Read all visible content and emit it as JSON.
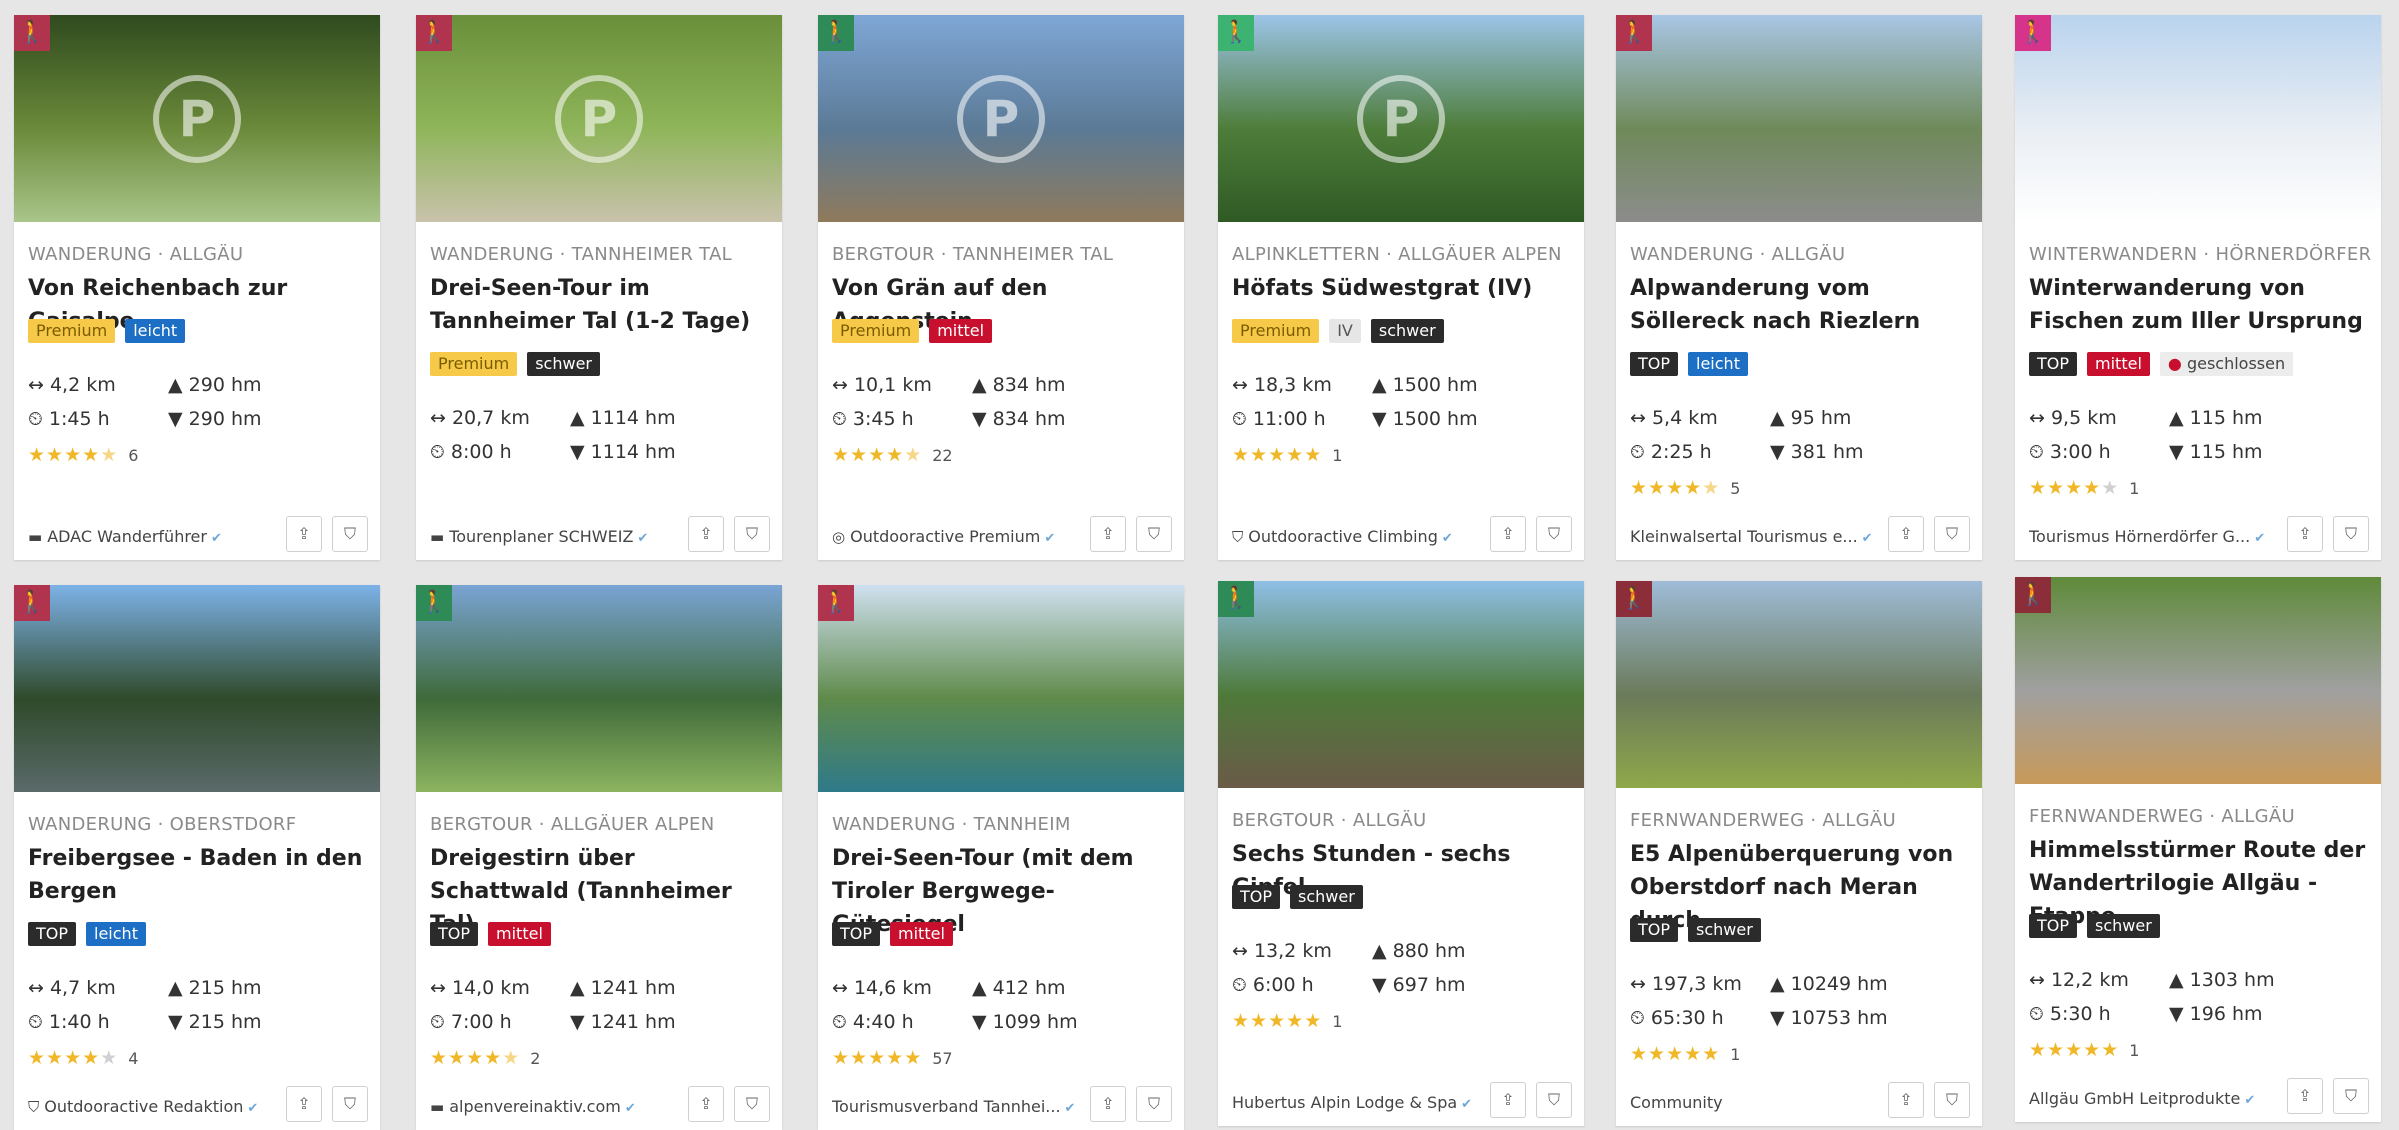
{
  "cards": [
    {
      "category": "WANDERUNG · ALLGÄU",
      "title": "Von Reichenbach zur Gaisalpe",
      "badge_color": "#b0344d",
      "image_colors": [
        "#2f4a1e",
        "#6b8a3a",
        "#a9c58a"
      ],
      "premium_watermark": true,
      "tags": [
        {
          "label": "Premium",
          "kind": "prem"
        },
        {
          "label": "leicht",
          "kind": "leicht"
        }
      ],
      "distance": "4,2 km",
      "duration": "1:45 h",
      "ascent": "290 hm",
      "descent": "290 hm",
      "rating": 4.5,
      "rating_count": "6",
      "author": "ADAC Wanderführer",
      "author_logo": "flag-icon",
      "verified": true
    },
    {
      "category": "WANDERUNG · TANNHEIMER TAL",
      "title": "Drei-Seen-Tour im Tannheimer Tal (1-2 Tage)",
      "badge_color": "#b0344d",
      "image_colors": [
        "#6a8f3a",
        "#8fb55a",
        "#c9c2ac"
      ],
      "premium_watermark": true,
      "tags": [
        {
          "label": "Premium",
          "kind": "prem"
        },
        {
          "label": "schwer",
          "kind": "schwer"
        }
      ],
      "distance": "20,7 km",
      "duration": "8:00 h",
      "ascent": "1114 hm",
      "descent": "1114 hm",
      "rating": 0,
      "rating_count": "",
      "author": "Tourenplaner SCHWEIZ",
      "author_logo": "flag-icon",
      "verified": true
    },
    {
      "category": "BERGTOUR · TANNHEIMER TAL",
      "title": "Von Grän auf den Aggenstein",
      "badge_color": "#2e8b57",
      "image_colors": [
        "#7fa7d6",
        "#5b7a96",
        "#8f7a5c"
      ],
      "premium_watermark": true,
      "tags": [
        {
          "label": "Premium",
          "kind": "prem"
        },
        {
          "label": "mittel",
          "kind": "mittel"
        }
      ],
      "distance": "10,1 km",
      "duration": "3:45 h",
      "ascent": "834 hm",
      "descent": "834 hm",
      "rating": 4.5,
      "rating_count": "22",
      "author": "Outdooractive Premium",
      "author_logo": "premium-icon",
      "verified": true
    },
    {
      "category": "ALPINKLETTERN · ALLGÄUER ALPEN",
      "title": "Höfats Südwestgrat (IV)",
      "badge_color": "#3cb371",
      "image_colors": [
        "#9cc4e8",
        "#4e7d3a",
        "#2f5a25"
      ],
      "premium_watermark": true,
      "tags": [
        {
          "label": "Premium",
          "kind": "prem"
        },
        {
          "label": "IV",
          "kind": "iv"
        },
        {
          "label": "schwer",
          "kind": "schwer"
        }
      ],
      "distance": "18,3 km",
      "duration": "11:00 h",
      "ascent": "1500 hm",
      "descent": "1500 hm",
      "rating": 5,
      "rating_count": "1",
      "author": "Outdooractive Climbing",
      "author_logo": "shield-icon",
      "verified": true
    },
    {
      "category": "WANDERUNG · ALLGÄU",
      "title": "Alpwanderung vom Söllereck nach Riezlern",
      "badge_color": "#b0344d",
      "image_colors": [
        "#a9c6e6",
        "#6f8a5a",
        "#8c8c8c"
      ],
      "premium_watermark": false,
      "tags": [
        {
          "label": "TOP",
          "kind": "top"
        },
        {
          "label": "leicht",
          "kind": "leicht"
        }
      ],
      "distance": "5,4 km",
      "duration": "2:25 h",
      "ascent": "95 hm",
      "descent": "381 hm",
      "rating": 4.5,
      "rating_count": "5",
      "author": "Kleinwalsertal Tourismus e...",
      "author_logo": "",
      "verified": true
    },
    {
      "category": "WINTERWANDERN · HÖRNERDÖRFER",
      "title": "Winterwanderung von Fischen zum Iller Ursprung",
      "badge_color": "#d6338a",
      "image_colors": [
        "#b9d3ee",
        "#e9eef4",
        "#ffffff"
      ],
      "premium_watermark": false,
      "tags": [
        {
          "label": "TOP",
          "kind": "top"
        },
        {
          "label": "mittel",
          "kind": "mittel"
        },
        {
          "label": "geschlossen",
          "kind": "closed"
        }
      ],
      "distance": "9,5 km",
      "duration": "3:00 h",
      "ascent": "115 hm",
      "descent": "115 hm",
      "rating": 4,
      "rating_count": "1",
      "author": "Tourismus Hörnerdörfer G...",
      "author_logo": "",
      "verified": true
    },
    {
      "category": "WANDERUNG · OBERSTDORF",
      "title": "Freibergsee - Baden in den Bergen",
      "badge_color": "#b0344d",
      "image_colors": [
        "#7db2e8",
        "#2f4a2a",
        "#5a6a6a"
      ],
      "premium_watermark": false,
      "tags": [
        {
          "label": "TOP",
          "kind": "top"
        },
        {
          "label": "leicht",
          "kind": "leicht"
        }
      ],
      "distance": "4,7 km",
      "duration": "1:40 h",
      "ascent": "215 hm",
      "descent": "215 hm",
      "rating": 4,
      "rating_count": "4",
      "author": "Outdooractive Redaktion",
      "author_logo": "shield-icon",
      "verified": true
    },
    {
      "category": "BERGTOUR · ALLGÄUER ALPEN",
      "title": "Dreigestirn über Schattwald (Tannheimer Tal)",
      "badge_color": "#2e8b57",
      "image_colors": [
        "#7aa4d4",
        "#3f6a3a",
        "#8cb460"
      ],
      "premium_watermark": false,
      "tags": [
        {
          "label": "TOP",
          "kind": "top"
        },
        {
          "label": "mittel",
          "kind": "mittel"
        }
      ],
      "distance": "14,0 km",
      "duration": "7:00 h",
      "ascent": "1241 hm",
      "descent": "1241 hm",
      "rating": 4.5,
      "rating_count": "2",
      "author": "alpenvereinaktiv.com",
      "author_logo": "flag-icon",
      "verified": true
    },
    {
      "category": "WANDERUNG · TANNHEIM",
      "title": "Drei-Seen-Tour (mit dem Tiroler Bergwege-Gütesiegel",
      "badge_color": "#b0344d",
      "image_colors": [
        "#cfe0f0",
        "#5f8a4a",
        "#2f7a8a"
      ],
      "premium_watermark": false,
      "tags": [
        {
          "label": "TOP",
          "kind": "top"
        },
        {
          "label": "mittel",
          "kind": "mittel"
        }
      ],
      "distance": "14,6 km",
      "duration": "4:40 h",
      "ascent": "412 hm",
      "descent": "1099 hm",
      "rating": 5,
      "rating_count": "57",
      "author": "Tourismusverband Tannhei...",
      "author_logo": "",
      "verified": true
    },
    {
      "category": "BERGTOUR · ALLGÄU",
      "title": "Sechs Stunden - sechs Gipfel",
      "badge_color": "#2e8b57",
      "image_colors": [
        "#8fbfe6",
        "#4e7a3a",
        "#6a5a48"
      ],
      "premium_watermark": false,
      "tags": [
        {
          "label": "TOP",
          "kind": "top"
        },
        {
          "label": "schwer",
          "kind": "schwer"
        }
      ],
      "distance": "13,2 km",
      "duration": "6:00 h",
      "ascent": "880 hm",
      "descent": "697 hm",
      "rating": 5,
      "rating_count": "1",
      "author": "Hubertus Alpin Lodge & Spa",
      "author_logo": "",
      "verified": true
    },
    {
      "category": "FERNWANDERWEG · ALLGÄU",
      "title": "E5 Alpenüberquerung von Oberstdorf nach Meran durch",
      "badge_color": "#8b2e3a",
      "image_colors": [
        "#9fbcd8",
        "#6a7a5a",
        "#8fa84a"
      ],
      "premium_watermark": false,
      "tags": [
        {
          "label": "TOP",
          "kind": "top"
        },
        {
          "label": "schwer",
          "kind": "schwer"
        }
      ],
      "distance": "197,3 km",
      "duration": "65:30 h",
      "ascent": "10249 hm",
      "descent": "10753 hm",
      "rating": 5,
      "rating_count": "1",
      "author": "Community",
      "author_logo": "",
      "verified": false
    },
    {
      "category": "FERNWANDERWEG · ALLGÄU",
      "title": "Himmelsstürmer Route der Wandertrilogie Allgäu - Etappe",
      "badge_color": "#8b2e3a",
      "image_colors": [
        "#5f8a3a",
        "#a0a0a0",
        "#c89a5a"
      ],
      "premium_watermark": false,
      "tags": [
        {
          "label": "TOP",
          "kind": "top"
        },
        {
          "label": "schwer",
          "kind": "schwer"
        }
      ],
      "distance": "12,2 km",
      "duration": "5:30 h",
      "ascent": "1303 hm",
      "descent": "196 hm",
      "rating": 5,
      "rating_count": "1",
      "author": "Allgäu GmbH Leitprodukte",
      "author_logo": "",
      "verified": true
    }
  ]
}
